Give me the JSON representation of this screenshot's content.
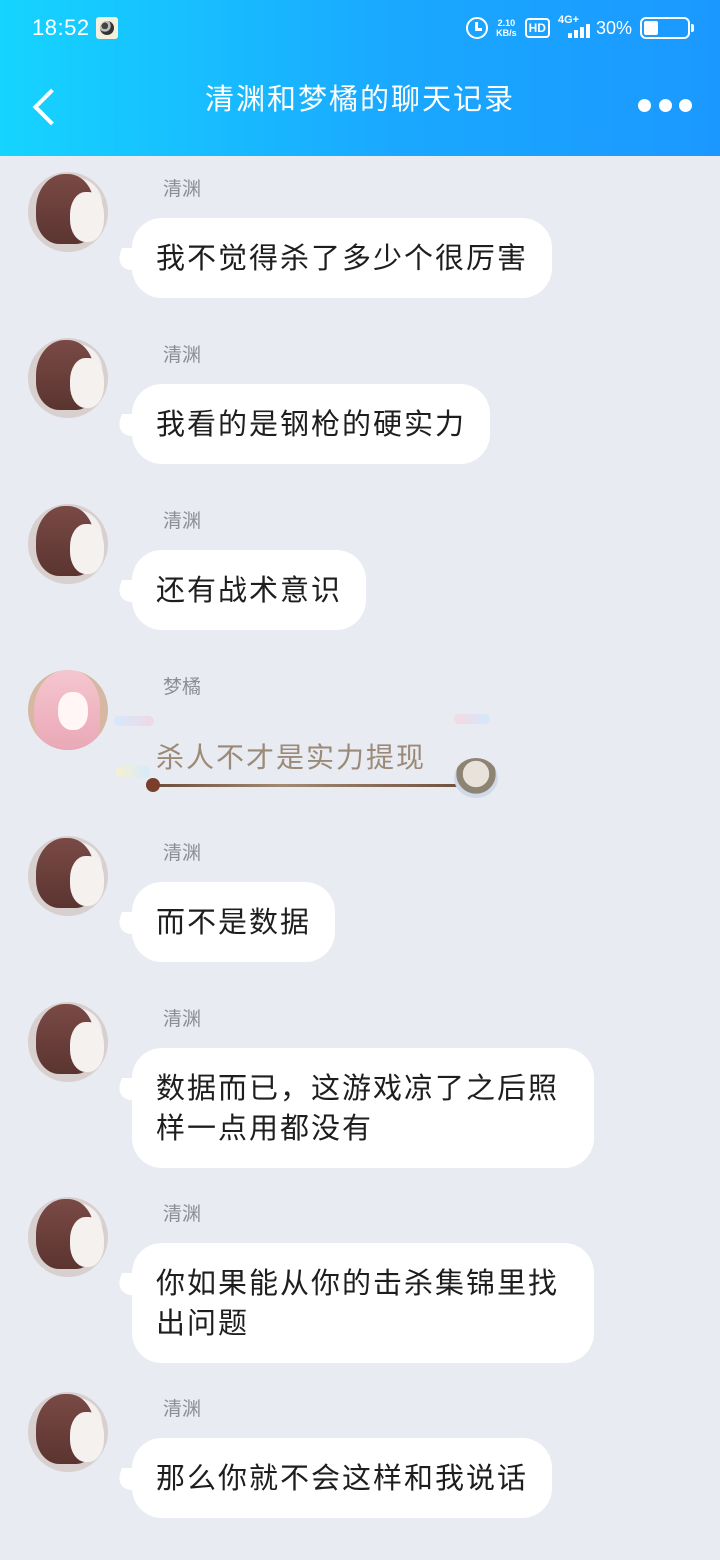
{
  "status_bar": {
    "time": "18:52",
    "net_speed_value": "2.10",
    "net_speed_unit": "KB/s",
    "hd_label": "HD",
    "network_label": "4G+",
    "battery_percent": "30%",
    "battery_level": 0.3
  },
  "header": {
    "title": "清渊和梦橘的聊天记录"
  },
  "messages": [
    {
      "sender": "清渊",
      "text": "我不觉得杀了多少个很厉害"
    },
    {
      "sender": "清渊",
      "text": "我看的是钢枪的硬实力"
    },
    {
      "sender": "清渊",
      "text": "还有战术意识"
    },
    {
      "sender": "梦橘",
      "text": "杀人不才是实力提现"
    },
    {
      "sender": "清渊",
      "text": "而不是数据"
    },
    {
      "sender": "清渊",
      "text": "数据而已，这游戏凉了之后照样一点用都没有"
    },
    {
      "sender": "清渊",
      "text": "你如果能从你的击杀集锦里找出问题"
    },
    {
      "sender": "清渊",
      "text": "那么你就不会这样和我说话"
    }
  ],
  "colors": {
    "header_start": "#15d4ff",
    "header_end": "#1b98ff",
    "background": "#e9ebf2",
    "bubble": "#ffffff",
    "sender_name": "#8c8e96"
  }
}
